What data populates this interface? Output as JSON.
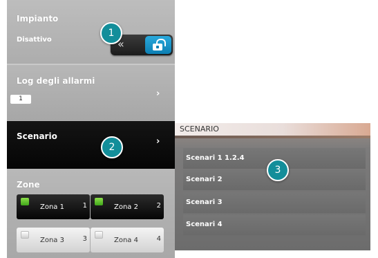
{
  "impianto": {
    "title": "Impianto",
    "status": "Disattivo",
    "toggle_arrow": "«",
    "lock_icon": "unlock-icon"
  },
  "log": {
    "title": "Log degli allarmi",
    "count": "1",
    "chevron": "›"
  },
  "scenario": {
    "title": "Scenario",
    "chevron": "›"
  },
  "zone": {
    "title": "Zone",
    "items": [
      {
        "name": "Zona 1",
        "number": "1",
        "state": "active"
      },
      {
        "name": "Zona 2",
        "number": "2",
        "state": "active"
      },
      {
        "name": "Zona 3",
        "number": "3",
        "state": "inactive"
      },
      {
        "name": "Zona 4",
        "number": "4",
        "state": "inactive"
      }
    ]
  },
  "panel": {
    "header": "SCENARIO",
    "items": [
      "Scenari 1 1.2.4",
      "Scenari 2",
      "Scenari 3",
      "Scenari 4"
    ]
  },
  "callouts": [
    "1",
    "2",
    "3"
  ],
  "colors": {
    "callout_teal": "#138e9a",
    "lock_blue": "#1e95c8",
    "led_green": "#5cc22c"
  }
}
